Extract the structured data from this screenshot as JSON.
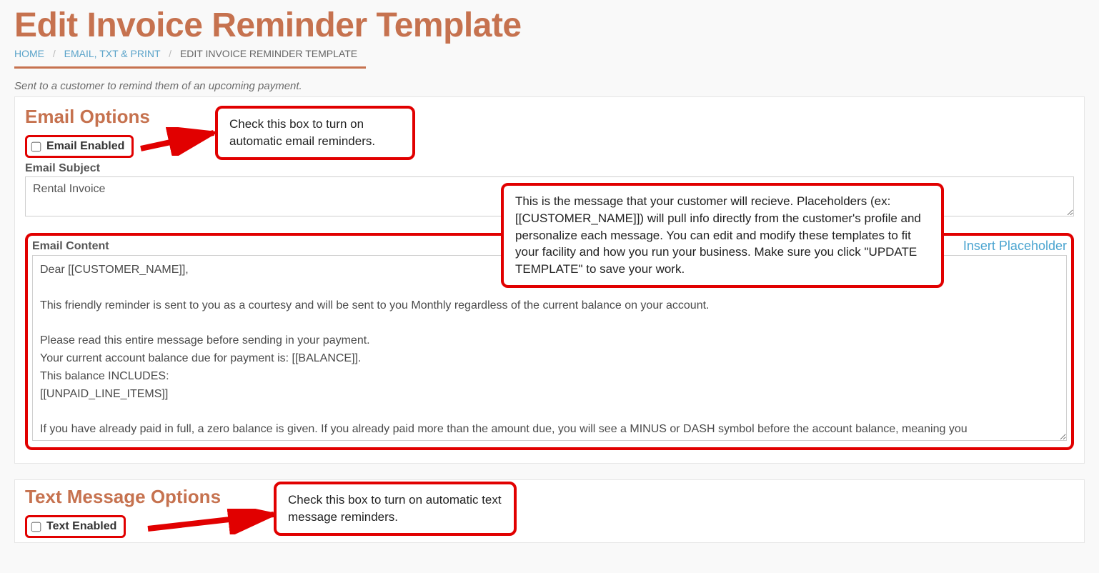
{
  "page": {
    "title": "Edit Invoice Reminder Template",
    "subtext": "Sent to a customer to remind them of an upcoming payment."
  },
  "breadcrumb": {
    "home": "HOME",
    "mid": "EMAIL, TXT & PRINT",
    "current": "EDIT INVOICE REMINDER TEMPLATE"
  },
  "email": {
    "section_title": "Email Options",
    "checkbox_label": "Email Enabled",
    "subject_label": "Email Subject",
    "subject_value": "Rental Invoice",
    "content_label": "Email Content",
    "insert_placeholder": "Insert Placeholder",
    "content_value": "Dear [[CUSTOMER_NAME]],\n\nThis friendly reminder is sent to you as a courtesy and will be sent to you Monthly regardless of the current balance on your account.\n\nPlease read this entire message before sending in your payment.\nYour current account balance due for payment is: [[BALANCE]].\nThis balance INCLUDES:\n[[UNPAID_LINE_ITEMS]]\n\nIf you have already paid in full, a zero balance is given. If you already paid more than the amount due, you will see a MINUS or DASH symbol before the account balance, meaning you"
  },
  "text": {
    "section_title": "Text Message Options",
    "checkbox_label": "Text Enabled"
  },
  "callouts": {
    "c1": "Check this box to turn on automatic email reminders.",
    "c2": "This is the message that your customer will recieve. Placeholders (ex: [[CUSTOMER_NAME]]) will pull info directly from the customer's profile and personalize each message. You can edit and modify these templates to fit your facility and how you run your business.  Make sure you click \"UPDATE TEMPLATE\" to save your work.",
    "c3": "Check this box to turn on automatic text message reminders."
  }
}
